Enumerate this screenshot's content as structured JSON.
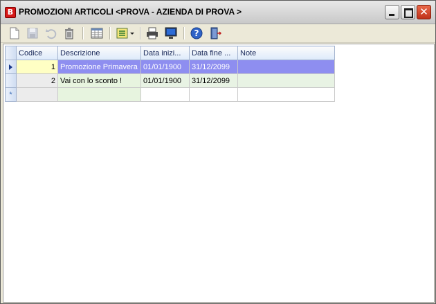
{
  "window": {
    "title": "PROMOZIONI ARTICOLI <PROVA - AZIENDA DI PROVA >",
    "app_icon_letter": "B"
  },
  "toolbar": {
    "buttons": [
      {
        "name": "new-document-icon",
        "enabled": true
      },
      {
        "name": "save-disk-icon",
        "enabled": false
      },
      {
        "name": "undo-icon",
        "enabled": false
      },
      {
        "name": "trash-icon",
        "enabled": true
      },
      {
        "name": "grid-view-icon",
        "enabled": true
      },
      {
        "name": "columns-dropdown-icon",
        "enabled": true
      },
      {
        "name": "print-icon",
        "enabled": true
      },
      {
        "name": "monitor-preview-icon",
        "enabled": true
      },
      {
        "name": "help-icon",
        "enabled": true
      },
      {
        "name": "exit-door-icon",
        "enabled": true
      }
    ]
  },
  "grid": {
    "columns": [
      "Codice",
      "Descrizione",
      "Data inizi...",
      "Data fine ...",
      "Note"
    ],
    "rows": [
      {
        "codice": "1",
        "descrizione": "Promozione Primavera",
        "data_inizio": "01/01/1900",
        "data_fine": "31/12/2099",
        "note": ""
      },
      {
        "codice": "2",
        "descrizione": "Vai con lo sconto !",
        "data_inizio": "01/01/1900",
        "data_fine": "31/12/2099",
        "note": ""
      }
    ],
    "selected_row_index": 0,
    "new_row_marker": "*"
  },
  "colors": {
    "selection": "#8e8ef0",
    "current_cell": "#ffffc4",
    "header_gradient_end": "#ddeafb"
  }
}
